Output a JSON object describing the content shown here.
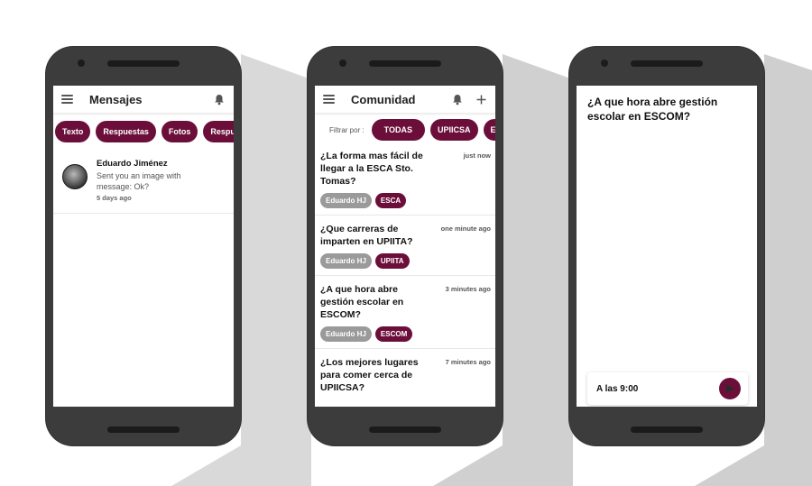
{
  "phone1": {
    "title": "Mensajes",
    "chips": [
      "Texto",
      "Respuestas",
      "Fotos",
      "Respuestas"
    ],
    "message": {
      "name": "Eduardo Jiménez",
      "line1": "Sent you an image with",
      "line2": "message: Ok?",
      "time": "5 days ago"
    }
  },
  "phone2": {
    "title": "Comunidad",
    "filter_label": "Filtrar por :",
    "chips": [
      "TODAS",
      "UPIICSA",
      "ESCOM"
    ],
    "posts": [
      {
        "title": "¿La forma mas fácil de llegar a la ESCA Sto. Tomas?",
        "time": "just now",
        "user": "Eduardo HJ",
        "school": "ESCA"
      },
      {
        "title": "¿Que carreras de imparten en UPIITA?",
        "time": "one minute ago",
        "user": "Eduardo HJ",
        "school": "UPIITA"
      },
      {
        "title": "¿A que hora abre gestión escolar en ESCOM?",
        "time": "3 minutes ago",
        "user": "Eduardo HJ",
        "school": "ESCOM"
      },
      {
        "title": "¿Los mejores lugares para comer cerca de UPIICSA?",
        "time": "7 minutes ago",
        "user": "",
        "school": ""
      }
    ]
  },
  "phone3": {
    "question": "¿A que hora abre gestión escolar en ESCOM?",
    "reply_value": "A las 9:00"
  },
  "colors": {
    "accent": "#6b0f3a",
    "user_tag": "#9a9a9a",
    "phone_body": "#3c3c3c",
    "shadow": "#cfcfcf"
  },
  "icons": [
    "menu-icon",
    "bell-icon",
    "plus-icon",
    "send-icon"
  ]
}
